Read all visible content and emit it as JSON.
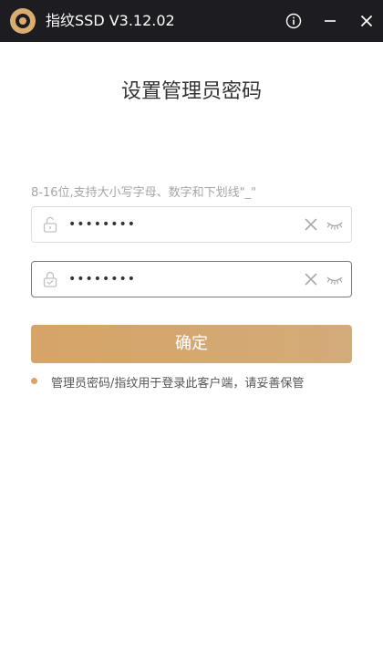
{
  "titlebar": {
    "title": "指纹SSD V3.12.02",
    "icons": {
      "logo": "disc-logo-icon",
      "info": "info-icon",
      "minimize": "minimize-icon",
      "close": "close-icon"
    }
  },
  "page": {
    "title": "设置管理员密码",
    "hint": "8-16位,支持大小写字母、数字和下划线\"_\""
  },
  "fields": [
    {
      "value": "********",
      "lead_icon": "unlock-icon",
      "clear_icon": "clear-icon",
      "eye_icon": "eye-closed-icon"
    },
    {
      "value": "********",
      "lead_icon": "lock-check-icon",
      "clear_icon": "clear-icon",
      "eye_icon": "eye-closed-icon"
    }
  ],
  "confirm": {
    "label": "确定"
  },
  "note": {
    "text": "管理员密码/指纹用于登录此客户端，请妥善保管"
  },
  "colors": {
    "titlebar_bg": "#1c1c21",
    "accent": "#d6a467",
    "accent_end": "#d3ab79",
    "focus_border": "#7a7a7a"
  }
}
